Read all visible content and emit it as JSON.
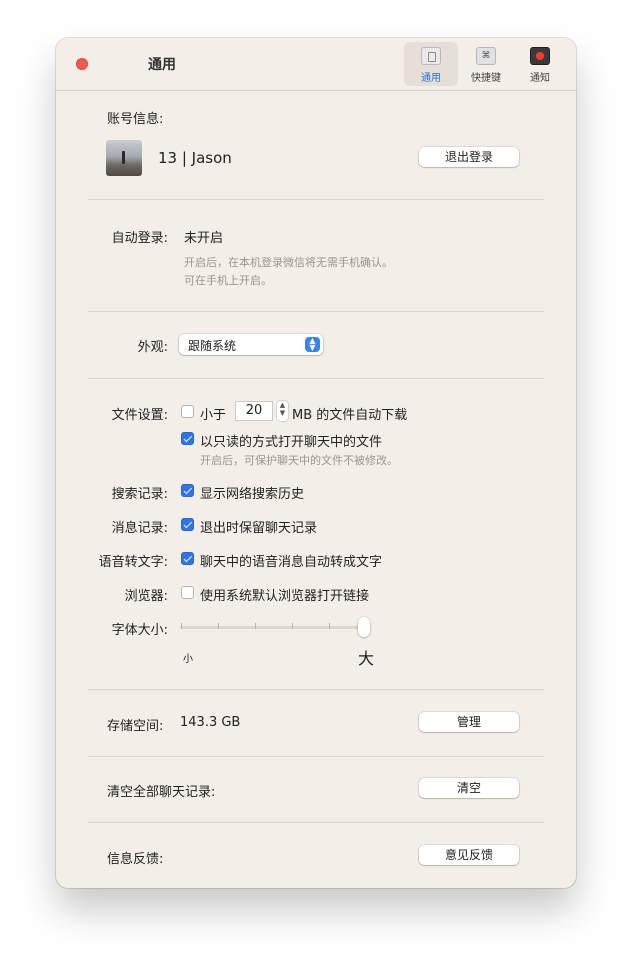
{
  "titlebar": {
    "title": "通用",
    "tabs": [
      {
        "label": "通用",
        "icon": "general-icon",
        "active": true
      },
      {
        "label": "快捷键",
        "icon": "shortcut-icon",
        "glyph": "⌘"
      },
      {
        "label": "通知",
        "icon": "notification-icon"
      }
    ]
  },
  "account": {
    "label": "账号信息:",
    "name": "13 | Jason",
    "logout_button": "退出登录"
  },
  "auto_login": {
    "label": "自动登录:",
    "value": "未开启",
    "hint_line1": "开启后，在本机登录微信将无需手机确认。",
    "hint_line2": "可在手机上开启。"
  },
  "appearance": {
    "label": "外观:",
    "selected": "跟随系统"
  },
  "file_settings": {
    "label": "文件设置:",
    "auto_download_checked": false,
    "prefix": "小于",
    "size_value": "20",
    "suffix": "MB 的文件自动下载",
    "readonly_checked": true,
    "readonly_text": "以只读的方式打开聊天中的文件",
    "readonly_hint": "开启后，可保护聊天中的文件不被修改。"
  },
  "search_history": {
    "label": "搜索记录:",
    "checked": true,
    "text": "显示网络搜索历史"
  },
  "message_history": {
    "label": "消息记录:",
    "checked": true,
    "text": "退出时保留聊天记录"
  },
  "voice_to_text": {
    "label": "语音转文字:",
    "checked": true,
    "text": "聊天中的语音消息自动转成文字"
  },
  "browser": {
    "label": "浏览器:",
    "checked": false,
    "text": "使用系统默认浏览器打开链接"
  },
  "font_size": {
    "label": "字体大小:",
    "min_label": "小",
    "max_label": "大",
    "level": 6,
    "levels": 6
  },
  "storage": {
    "label": "存储空间:",
    "value": "143.3 GB",
    "button": "管理"
  },
  "clear_history": {
    "label": "清空全部聊天记录:",
    "button": "清空"
  },
  "feedback": {
    "label": "信息反馈:",
    "button": "意见反馈"
  },
  "colors": {
    "accent": "#2f74e8",
    "close": "#ee5a52",
    "window_bg": "#f3eee8"
  }
}
